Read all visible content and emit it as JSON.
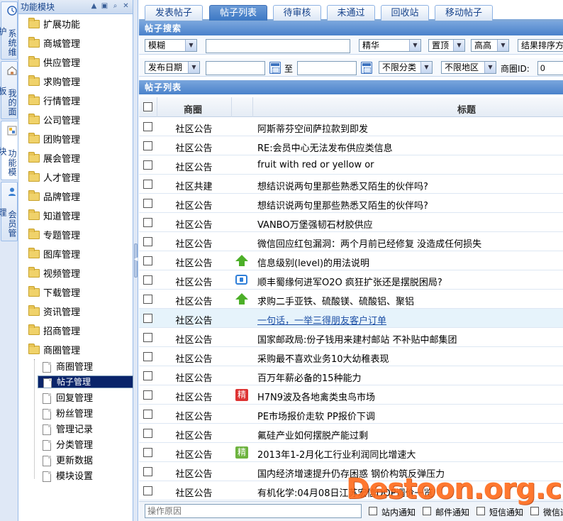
{
  "vtabs": [
    {
      "label": "系统维护",
      "icon": "clock-icon"
    },
    {
      "label": "我的面板",
      "icon": "home-icon"
    },
    {
      "label": "功能模块",
      "icon": "module-icon",
      "active": true
    },
    {
      "label": "会员管理",
      "icon": "user-icon"
    }
  ],
  "tree": {
    "title": "功能模块",
    "tools": [
      "pin-icon",
      "restore-icon",
      "search-icon",
      "close-icon"
    ],
    "folders": [
      "扩展功能",
      "商城管理",
      "供应管理",
      "求购管理",
      "行情管理",
      "公司管理",
      "团购管理",
      "展会管理",
      "人才管理",
      "品牌管理",
      "知道管理",
      "专题管理",
      "图库管理",
      "视频管理",
      "下载管理",
      "资讯管理",
      "招商管理",
      "商圈管理"
    ],
    "children": [
      "商圈管理",
      "帖子管理",
      "回复管理",
      "粉丝管理",
      "管理记录",
      "分类管理",
      "更新数据",
      "模块设置"
    ],
    "selected_child": 1
  },
  "tabs": [
    "发表帖子",
    "帖子列表",
    "待审核",
    "未通过",
    "回收站",
    "移动帖子"
  ],
  "active_tab": 1,
  "search": {
    "heading": "帖子搜索",
    "match_select": "模糊",
    "keyword": "",
    "level_select": "精华",
    "top_select": "置顶",
    "sort_select": "高高",
    "order_select": "结果排序方式",
    "date_select": "发布日期",
    "from_date": "",
    "to_label": "至",
    "to_date": "",
    "category_select": "不限分类",
    "area_select": "不限地区",
    "club_id_label": "商圈ID:",
    "club_id_value": "0"
  },
  "list": {
    "heading": "帖子列表",
    "col_club": "商圈",
    "col_title": "标题",
    "rows": [
      {
        "club": "社区公告",
        "title": "阿斯蒂芬空间萨拉款到即发",
        "mark": ""
      },
      {
        "club": "社区公告",
        "title": "RE:会员中心无法发布供应类信息",
        "mark": ""
      },
      {
        "club": "社区公告",
        "title": "fruit with red or yellow or",
        "mark": ""
      },
      {
        "club": "社区共建",
        "title": "想结识说两句里那些熟悉又陌生的伙伴吗?",
        "mark": ""
      },
      {
        "club": "社区公告",
        "title": "想结识说两句里那些熟悉又陌生的伙伴吗?",
        "mark": ""
      },
      {
        "club": "社区公告",
        "title": "VANBO万堡强韧石材胶供应",
        "mark": ""
      },
      {
        "club": "社区公告",
        "title": "微信回应红包漏洞：两个月前已经修复 没造成任何损失",
        "mark": ""
      },
      {
        "club": "社区公告",
        "title": "信息级别(level)的用法说明",
        "mark": "up"
      },
      {
        "club": "社区公告",
        "title": "顺丰蜀缘何进军O2O 疯狂扩张还是摆脱困局?",
        "mark": "video"
      },
      {
        "club": "社区公告",
        "title": "求购二手亚铁、硫酸镁、硫酸铝、聚铝",
        "mark": "up"
      },
      {
        "club": "社区公告",
        "title": "一句话，一举三得朋友客户订单",
        "mark": "",
        "highlight": true
      },
      {
        "club": "社区公告",
        "title": "国家邮政局:份子钱用来建村邮站 不补贴中邮集团",
        "mark": ""
      },
      {
        "club": "社区公告",
        "title": "采购最不喜欢业务10大幼稚表现",
        "mark": ""
      },
      {
        "club": "社区公告",
        "title": "百万年薪必备的15种能力",
        "mark": ""
      },
      {
        "club": "社区公告",
        "title": "H7N9波及各地禽类虫鸟市场",
        "mark": "jing-red"
      },
      {
        "club": "社区公告",
        "title": "PE市场报价走软 PP报价下调",
        "mark": ""
      },
      {
        "club": "社区公告",
        "title": "氟硅产业如何摆脱产能过剩",
        "mark": ""
      },
      {
        "club": "社区公告",
        "title": "2013年1-2月化工行业利润同比增速大",
        "mark": "jing-green"
      },
      {
        "club": "社区公告",
        "title": "国内经济增速提升仍存困惑 钢价构筑反弹压力",
        "mark": ""
      },
      {
        "club": "社区公告",
        "title": "有机化学:04月08日江苏宏信DOP调价一览",
        "mark": ""
      }
    ],
    "badge_text": "精"
  },
  "bottom": {
    "reason_placeholder": "操作原因",
    "notify": [
      "站内通知",
      "邮件通知",
      "短信通知",
      "微信通知"
    ]
  },
  "watermark": "Destoon.org.cn",
  "colors": {
    "accent": "#4a82cb",
    "selected": "#0a246a",
    "up": "#4caf28",
    "badge_red": "#d33",
    "badge_green": "#6db33f",
    "watermark": "#ff6a1a"
  }
}
